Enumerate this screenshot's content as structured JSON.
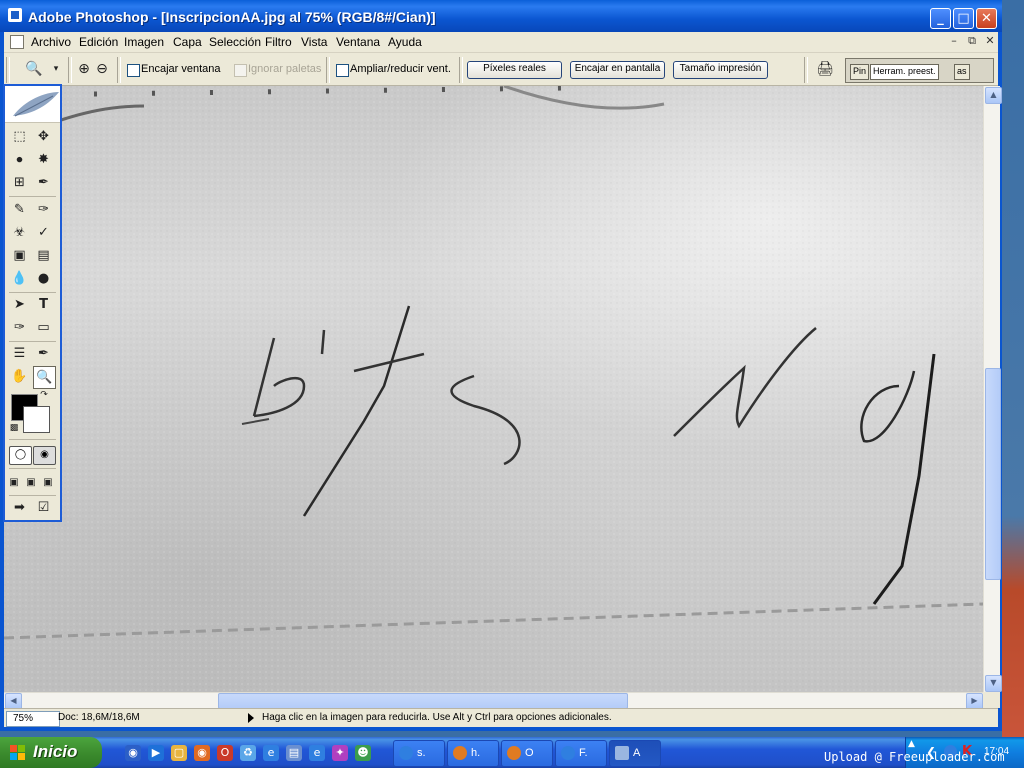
{
  "window": {
    "title": "Adobe Photoshop - [InscripcionAA.jpg al 75% (RGB/8#/Cian)]",
    "buttons": {
      "minimize": "_",
      "maximize": "□",
      "close": "✕"
    }
  },
  "menu": {
    "items": [
      "Archivo",
      "Edición",
      "Imagen",
      "Capa",
      "Selección",
      "Filtro",
      "Vista",
      "Ventana",
      "Ayuda"
    ],
    "mdi_controls": [
      "–",
      "⧉",
      "✕"
    ]
  },
  "options": {
    "encajar_ventana": {
      "label": "Encajar ventana",
      "checked": false
    },
    "ignorar_paletas": {
      "label": "Ignorar paletas",
      "checked": false,
      "disabled": true
    },
    "ampliar_reducir": {
      "label": "Ampliar/reducir vent.",
      "checked": false
    },
    "buttons": {
      "pixeles_reales": "Píxeles reales",
      "encajar_pantalla": "Encajar en pantalla",
      "tamano_impresion": "Tamaño impresión"
    },
    "palette_well": {
      "tab_a": "Pin",
      "tab_b": "Herram. preest.",
      "tab_c": "as"
    }
  },
  "status": {
    "zoom": "75%",
    "doc": "Doc: 18,6M/18,6M",
    "hint": "Haga clic en la imagen para reducirla. Use Alt y Ctrl para opciones adicionales."
  },
  "taskbar": {
    "start": "Inicio",
    "buttons": [
      {
        "label": "s.",
        "icon_color": "#2f7fe0"
      },
      {
        "label": "h.",
        "icon_color": "#e07b22"
      },
      {
        "label": "O",
        "icon_color": "#e07b22"
      },
      {
        "label": "F.",
        "icon_color": "#2f7fe0"
      },
      {
        "label": "A",
        "icon_color": "#9ab6e0"
      }
    ],
    "clock": "17:04"
  },
  "watermark": "Upload @ Freeuploader.com",
  "colors": {
    "foreground": "#000000",
    "background": "#ffffff",
    "xp_blue": "#0a55d0",
    "xp_green": "#3c8c2e"
  }
}
